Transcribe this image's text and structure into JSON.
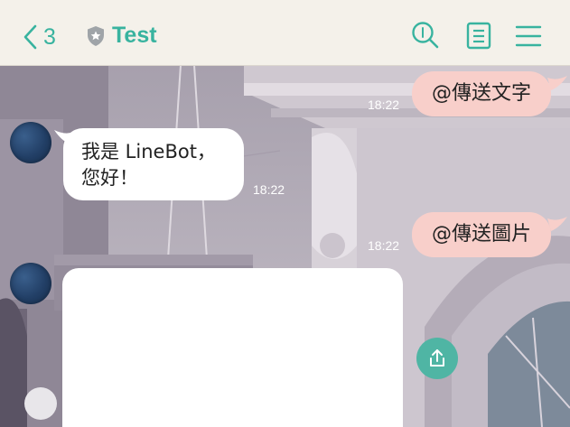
{
  "header": {
    "unread_count": "3",
    "chat_title": "Test",
    "accent_color": "#38b39f",
    "icons": [
      "back-chevron-icon",
      "shield-icon",
      "search-icon",
      "notes-icon",
      "menu-icon"
    ]
  },
  "messages": [
    {
      "direction": "out",
      "text": "@傳送文字",
      "time": "18:22"
    },
    {
      "direction": "in",
      "lines": [
        "我是 LineBot，",
        "您好！"
      ],
      "time": "18:22"
    },
    {
      "direction": "out",
      "text": "@傳送圖片",
      "time": "18:22"
    },
    {
      "direction": "in",
      "type": "image",
      "content": ""
    }
  ],
  "colors": {
    "outgoing_bubble": "#f8cfca",
    "incoming_bubble": "#ffffff",
    "header_bg": "#f4f1ea"
  },
  "share_button": {
    "icon": "share-upload-icon"
  }
}
